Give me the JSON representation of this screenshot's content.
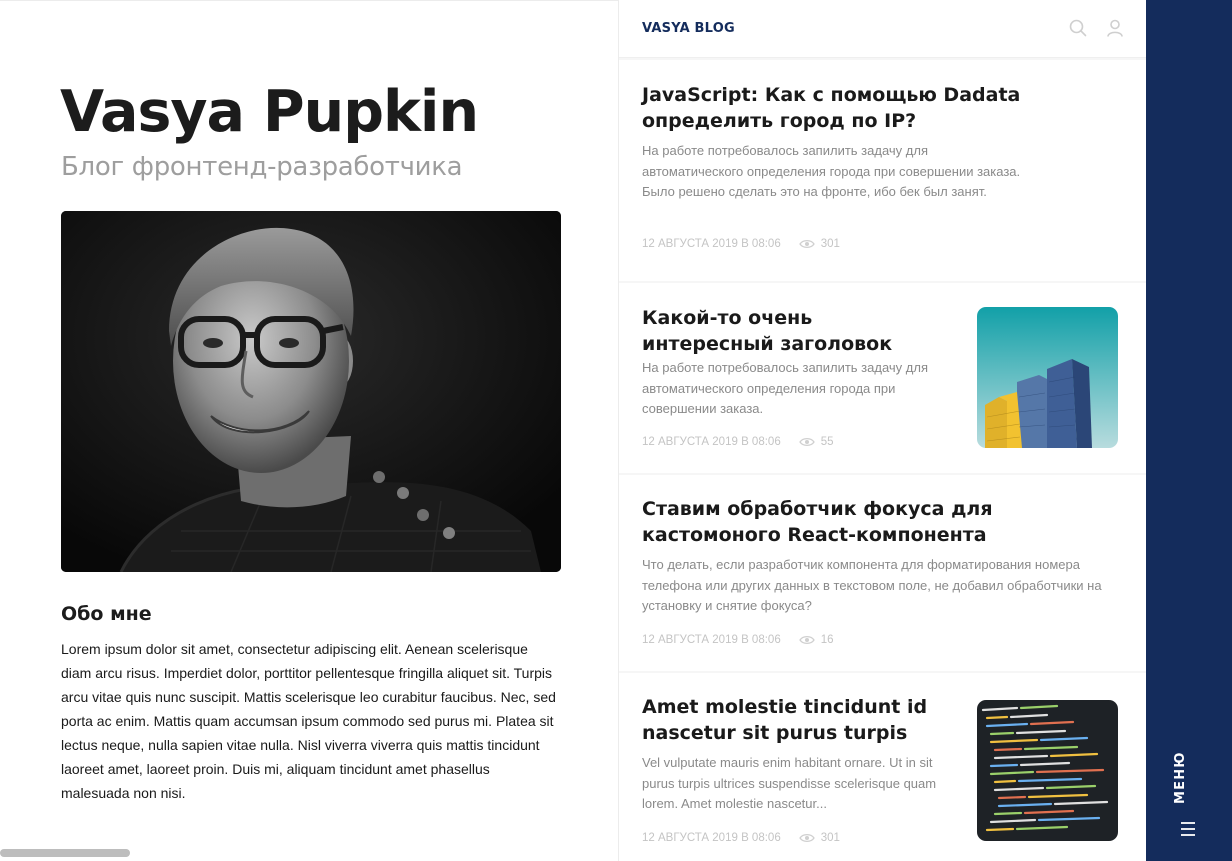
{
  "profile": {
    "name": "Vasya Pupkin",
    "subtitle": "Блог фронтенд-разработчика",
    "about_heading": "Обо мне",
    "about_text": "Lorem ipsum dolor sit amet, consectetur adipiscing elit. Aenean scelerisque diam arcu risus. Imperdiet dolor, porttitor pellentesque fringilla aliquet sit. Turpis arcu vitae quis nunc suscipit. Mattis scelerisque leo curabitur faucibus. Nec, sed porta ac enim. Mattis quam accumsan ipsum commodo sed purus mi. Platea sit lectus neque, nulla sapien vitae nulla. Nisl viverra viverra quis mattis tincidunt laoreet amet, laoreet proin. Duis mi, aliquam tincidunt amet phasellus malesuada non nisi."
  },
  "header": {
    "logo": "VASYA BLOG",
    "icons": [
      "search-icon",
      "user-icon"
    ]
  },
  "posts": [
    {
      "title": "JavaScript: Как с помощью Dadata определить город по IP?",
      "excerpt": "На работе потребовалось запилить задачу для автоматического определения города при совершении заказа. Было решено сделать это на фронте, ибо бек был занят.",
      "date": "12 АВГУСТА 2019 В 08:06",
      "views": "301"
    },
    {
      "title": "Какой-то очень интересный заголовок",
      "excerpt": "На работе потребовалось запилить задачу для автоматического определения города при совершении заказа.",
      "date": "12 АВГУСТА 2019 В 08:06",
      "views": "55",
      "thumbnail": "buildings-image"
    },
    {
      "title": "Ставим обработчик фокуса для кастомоного React-компонента",
      "excerpt": "Что делать, если разработчик компонента для форматирования номера телефона или других данных в текстовом поле, не добавил обработчики на установку и снятие фокуса?",
      "date": "12 АВГУСТА 2019 В 08:06",
      "views": "16"
    },
    {
      "title": "Amet molestie tincidunt id nascetur sit purus turpis",
      "excerpt": "Vel vulputate mauris enim habitant ornare. Ut in sit purus turpis ultrices suspendisse scelerisque quam lorem. Amet molestie nascetur...",
      "date": "12 АВГУСТА 2019 В 08:06",
      "views": "301",
      "thumbnail": "code-screen-image"
    }
  ],
  "menu": {
    "label": "МЕНЮ",
    "icon": "hamburger-icon"
  },
  "colors": {
    "accent": "#142c5c",
    "muted_text": "#8a8a8a",
    "meta_text": "#c4c4c4",
    "subtitle": "#9e9e9e"
  }
}
